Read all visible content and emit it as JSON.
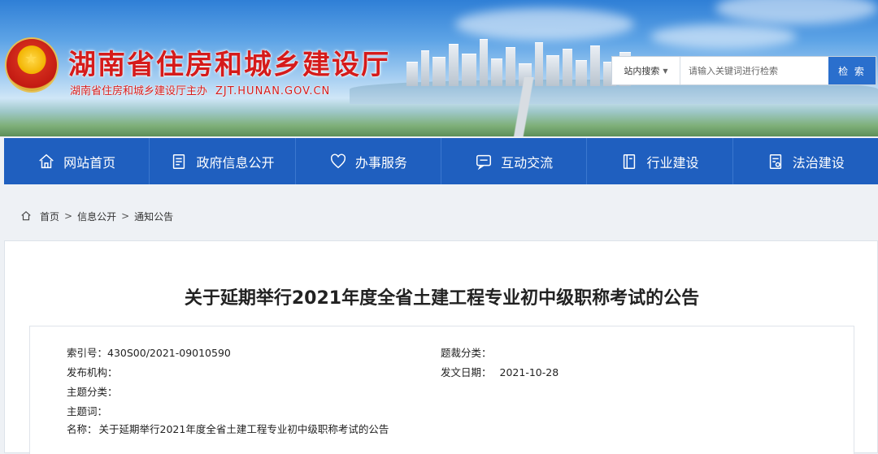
{
  "header": {
    "title": "湖南省住房和城乡建设厅",
    "subtitle": "湖南省住房和城乡建设厅主办",
    "url": "ZJT.HUNAN.GOV.CN"
  },
  "search": {
    "scope": "站内搜索",
    "placeholder": "请输入关键词进行检索",
    "button": "检 索"
  },
  "nav": [
    {
      "label": "网站首页",
      "icon": "home-icon"
    },
    {
      "label": "政府信息公开",
      "icon": "document-icon"
    },
    {
      "label": "办事服务",
      "icon": "heart-icon"
    },
    {
      "label": "互动交流",
      "icon": "chat-icon"
    },
    {
      "label": "行业建设",
      "icon": "book-icon"
    },
    {
      "label": "法治建设",
      "icon": "law-icon"
    }
  ],
  "breadcrumb": {
    "items": [
      "首页",
      "信息公开",
      "通知公告"
    ],
    "sep": ">"
  },
  "article": {
    "title": "关于延期举行2021年度全省土建工程专业初中级职称考试的公告",
    "meta": {
      "index_label": "索引号：",
      "index_value": "430S00/2021-09010590",
      "genre_label": "题裁分类：",
      "genre_value": "",
      "org_label": "发布机构：",
      "org_value": "",
      "date_label": "发文日期：",
      "date_value": "2021-10-28",
      "topic_label": "主题分类：",
      "topic_value": "",
      "keyword_label": "主题词：",
      "keyword_value": "",
      "name_label": "名称：",
      "name_value": "关于延期举行2021年度全省土建工程专业初中级职称考试的公告"
    }
  },
  "colors": {
    "nav_bg": "#1f5fbf",
    "title_red": "#d51b1b",
    "search_btn": "#2a6fcd"
  }
}
